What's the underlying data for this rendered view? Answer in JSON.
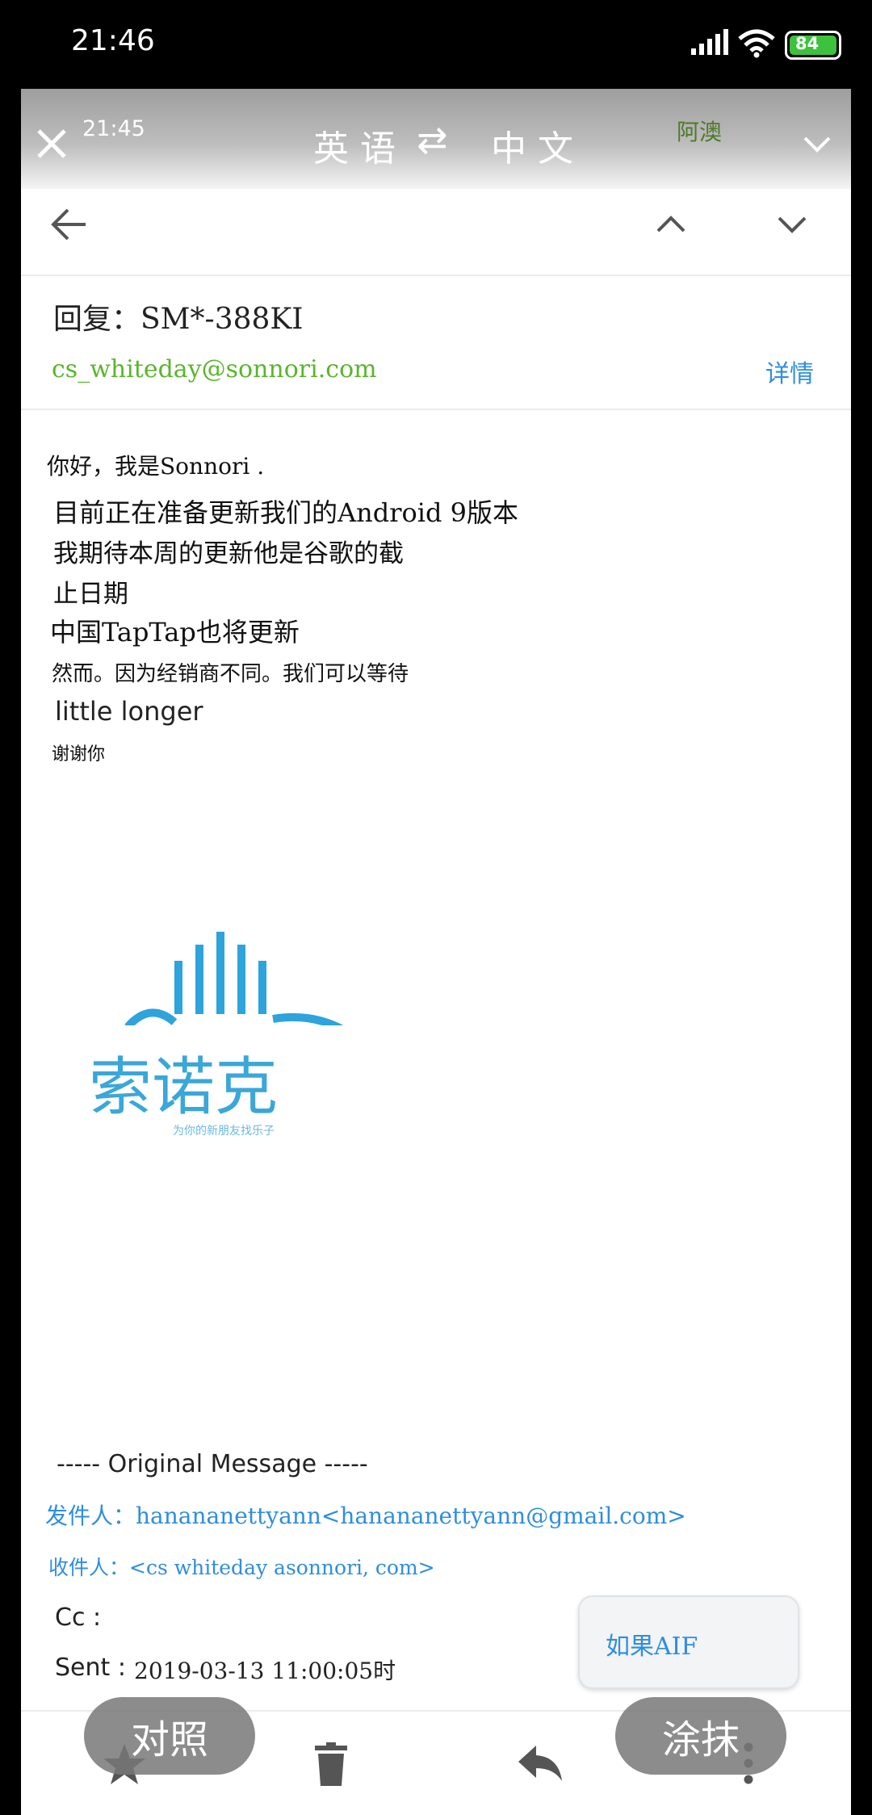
{
  "status_bar": {
    "time": "21:46",
    "battery": "84"
  },
  "translate_bar": {
    "time": "21:45",
    "source_lang": "英语",
    "swap_symbol": "⇄",
    "target_lang": "中文",
    "engine": "阿澳"
  },
  "email": {
    "subject": "回复：SM*-388KI",
    "sender_email": "cs_whiteday@sonnori.com",
    "details_link": "详情",
    "body_lines": [
      "你好，我是Sonnori .",
      "目前正在准备更新我们的Android 9版本",
      "我期待本周的更新他是谷歌的截",
      "止日期",
      "中国TapTap也将更新",
      "然而。因为经销商不同。我们可以等待",
      "little longer",
      "谢谢你"
    ],
    "logo": {
      "name": "索诺克",
      "tagline": "为你的新朋友找乐子"
    },
    "original_message": {
      "divider": "----- Original Message -----",
      "from": "发件人：hanananettyann<hanananettyann@gmail.com>",
      "to": "收件人：<cs whiteday asonnori, com>",
      "cc_label": "Cc :",
      "sent_label": "Sent : ",
      "sent_value": "2019-03-13 11:00:05时"
    }
  },
  "overlay": {
    "compare_button": "对照",
    "smear_button": "涂抹",
    "tooltip": "如果AIF"
  },
  "colors": {
    "green": "#5ab52c",
    "blue": "#2f8de0",
    "logo_blue": "#3aa7d8"
  }
}
